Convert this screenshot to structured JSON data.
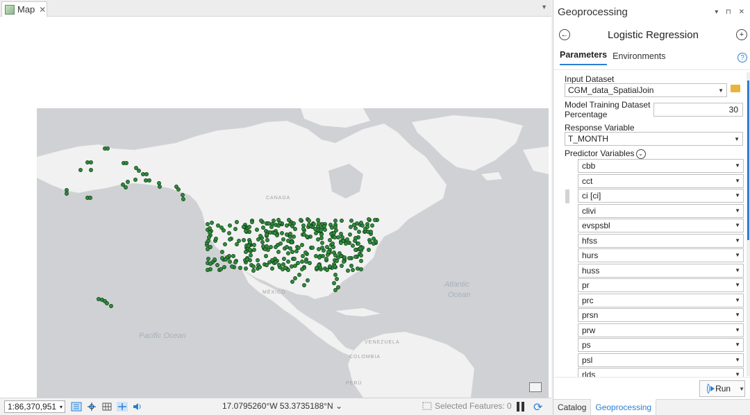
{
  "map_tab": {
    "label": "Map",
    "close": "✕"
  },
  "map": {
    "labels": {
      "canada": "CANADA",
      "mexico": "MÉXICO",
      "venezuela": "VENEZUELA",
      "colombia": "COLOMBIA",
      "peru": "PERÚ",
      "atlantic1": "Atlantic",
      "atlantic2": "Ocean",
      "pacific": "Pacific Ocean"
    },
    "point_color": "#2f8a3c"
  },
  "status": {
    "scale": "1:86,370,951",
    "coords": "17.0795260°W 53.3735188°N",
    "coords_arrow": "⌄",
    "selected_features": "Selected Features: 0"
  },
  "gp": {
    "header_title": "Geoprocessing",
    "header_controls": "▾ ⊓ ✕",
    "tool_title": "Logistic Regression",
    "tabs": [
      "Parameters",
      "Environments"
    ],
    "input_dataset_label": "Input Dataset",
    "input_dataset_value": "CGM_data_SpatialJoin",
    "training_pct_label_1": "Model Training Dataset",
    "training_pct_label_2": "Percentage",
    "training_pct_value": "30",
    "response_label": "Response Variable",
    "response_value": "T_MONTH",
    "predictor_label": "Predictor Variables",
    "predictors": [
      "cbb",
      "cct",
      "ci [ci]",
      "clivi",
      "evspsbl",
      "hfss",
      "hurs",
      "huss",
      "pr",
      "prc",
      "prsn",
      "prw",
      "ps",
      "psl",
      "rlds"
    ],
    "run_label": "Run"
  },
  "bottom_tabs": [
    "Catalog",
    "Geoprocessing"
  ],
  "colors": {
    "accent": "#2a7fd4",
    "land": "#f1f1f1",
    "water": "#cfd1d4"
  }
}
